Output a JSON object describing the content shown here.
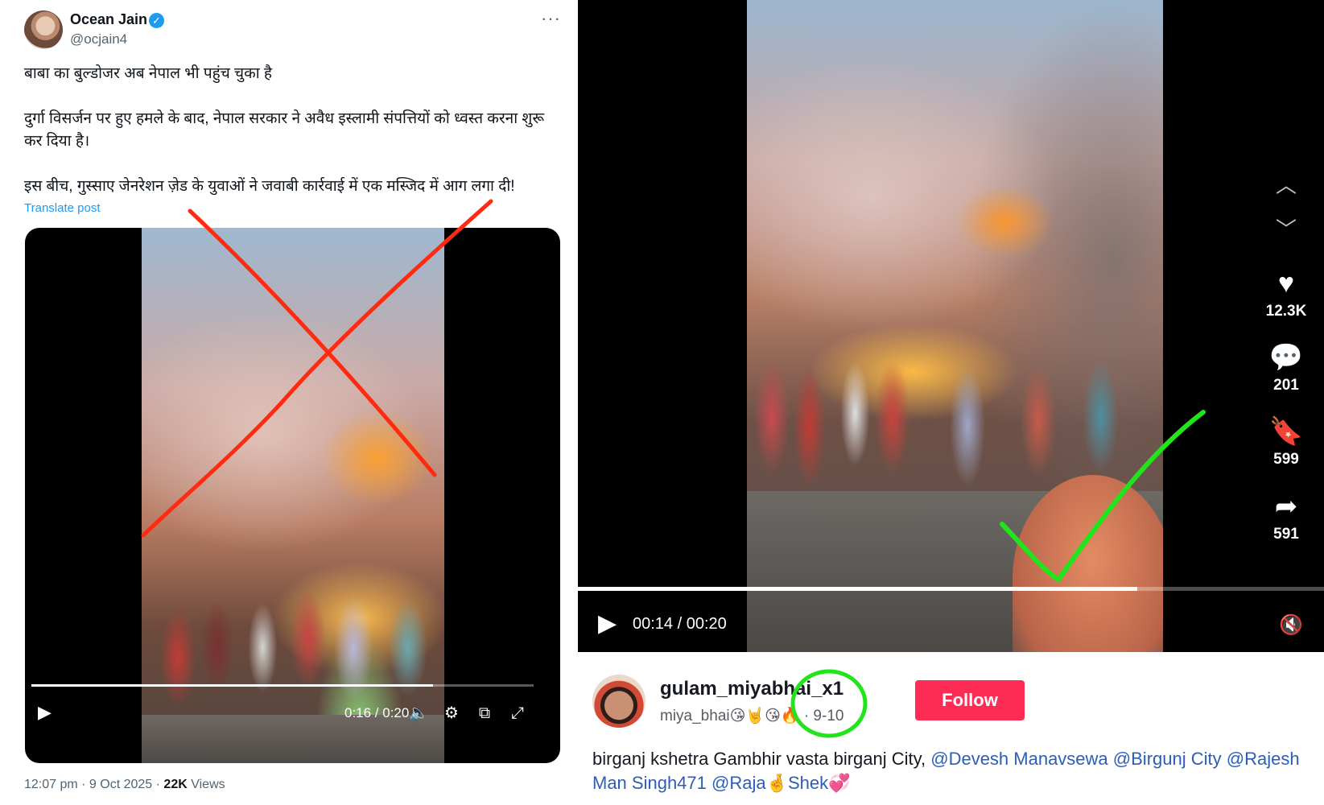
{
  "tweet": {
    "author_name": "Ocean Jain",
    "author_handle": "@ocjain4",
    "more_icon": "ellipsis-icon",
    "paragraphs": [
      "बाबा का बुल्डोजर अब नेपाल भी पहुंच चुका है",
      "दुर्गा विसर्जन पर हुए हमले के बाद, नेपाल सरकार ने अवैध इस्लामी संपत्तियों को ध्वस्त करना शुरू कर दिया है।",
      "इस बीच, गुस्साए जेनरेशन ज़ेड के युवाओं ने जवाबी कार्रवाई में एक मस्जिद में आग लगा दी!"
    ],
    "translate_label": "Translate post",
    "video": {
      "time": "0:16 / 0:20",
      "progress": 0.8
    },
    "time_posted": "12:07 pm · 9 Oct 2025",
    "views_count": "22K",
    "views_label": "Views",
    "accent_color": "#1d9bf0",
    "annotation_color": "#ff2a10"
  },
  "tiktok": {
    "video": {
      "time": "00:14 / 00:20",
      "progress": 0.75
    },
    "actions": {
      "likes": "12.3K",
      "comments": "201",
      "saves": "599",
      "shares": "591"
    },
    "username": "gulam_miyabhai_x1",
    "nickname": "miya_bhai😘🤘😘🔥",
    "date": "· 9-10",
    "follow_label": "Follow",
    "caption_text": "birganj kshetra Gambhir vasta birganj City,",
    "caption_tags": [
      "@Devesh Manavsewa",
      "@Birgunj City",
      "@Rajesh Man Singh471",
      "@Raja🤞Shek💞"
    ],
    "follow_color": "#fe2c55",
    "annotation_color": "#22e41a"
  }
}
